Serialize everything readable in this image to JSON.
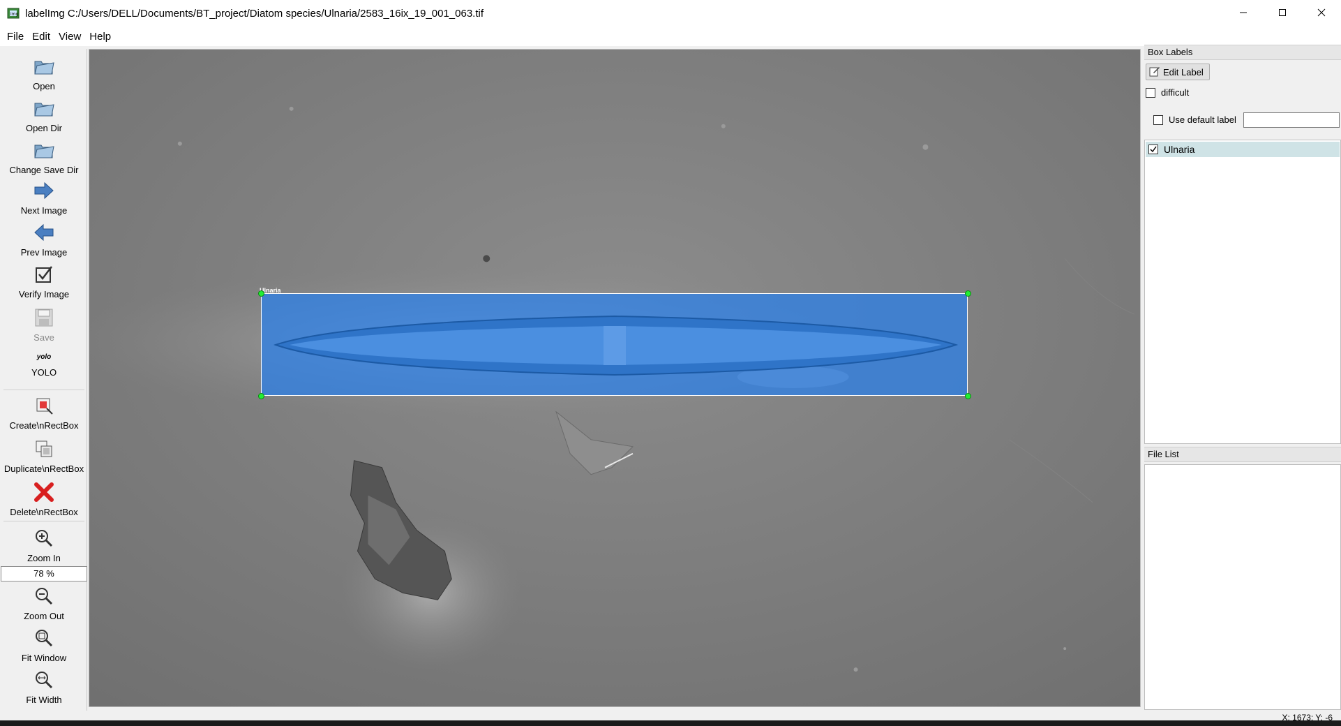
{
  "window": {
    "title": "labelImg C:/Users/DELL/Documents/BT_project/Diatom species/Ulnaria/2583_16ix_19_001_063.tif",
    "icons": [
      "app-icon",
      "minimize-icon",
      "maximize-icon",
      "close-icon"
    ]
  },
  "menu": {
    "file": "File",
    "edit": "Edit",
    "view": "View",
    "help": "Help"
  },
  "toolbar": {
    "open": "Open",
    "open_dir": "Open Dir",
    "change_save_dir": "Change Save Dir",
    "next_image": "Next Image",
    "prev_image": "Prev Image",
    "verify_image": "Verify Image",
    "save": "Save",
    "format_icon_text": "yolo",
    "format": "YOLO",
    "create_rect": "Create\\nRectBox",
    "duplicate_rect": "Duplicate\\nRectBox",
    "delete_rect": "Delete\\nRectBox",
    "zoom_in": "Zoom In",
    "zoom_value": "78 %",
    "zoom_out": "Zoom Out",
    "fit_window": "Fit Window",
    "fit_width": "Fit Width"
  },
  "canvas": {
    "box_label": "Ulnaria",
    "box_color": "#2880eb",
    "handle_color": "#22ee33"
  },
  "box_labels_panel": {
    "title": "Box Labels",
    "edit_label_button": "Edit Label",
    "difficult": "difficult",
    "difficult_checked": false,
    "use_default_label": "Use default label",
    "use_default_label_checked": false,
    "default_label_value": "",
    "labels": [
      {
        "name": "Ulnaria",
        "checked": true
      }
    ]
  },
  "file_list_panel": {
    "title": "File List",
    "files": []
  },
  "status": {
    "coords": "X: 1673; Y: -6"
  }
}
